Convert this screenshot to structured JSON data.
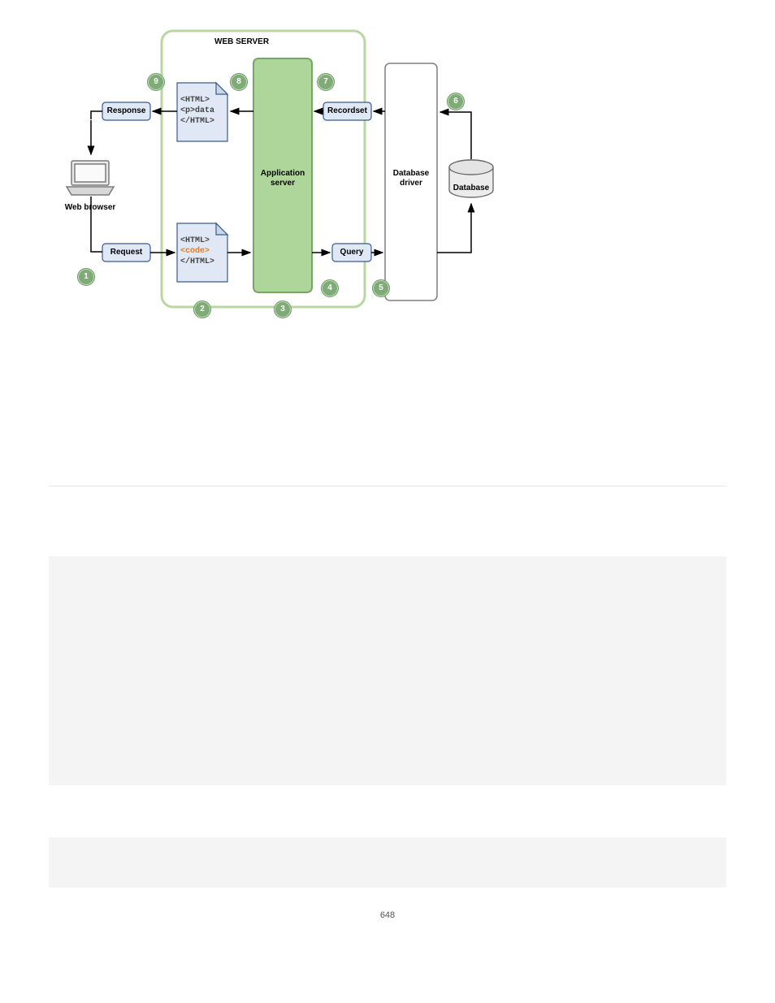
{
  "diagram": {
    "title": "WEB SERVER",
    "nodes": {
      "web_browser": "Web browser",
      "response": "Response",
      "request": "Request",
      "doc_response_lines": [
        "<HTML>",
        "<p>data",
        "</HTML>"
      ],
      "doc_request_lines": [
        "<HTML>",
        "<code>",
        "</HTML>"
      ],
      "app_server": "Application\nserver",
      "recordset": "Recordset",
      "query": "Query",
      "db_driver": "Database\ndriver",
      "database": "Database"
    },
    "badges": {
      "b1": "1",
      "b2": "2",
      "b3": "3",
      "b4": "4",
      "b5": "5",
      "b6": "6",
      "b7": "7",
      "b8": "8",
      "b9": "9"
    }
  },
  "page_number": "648"
}
